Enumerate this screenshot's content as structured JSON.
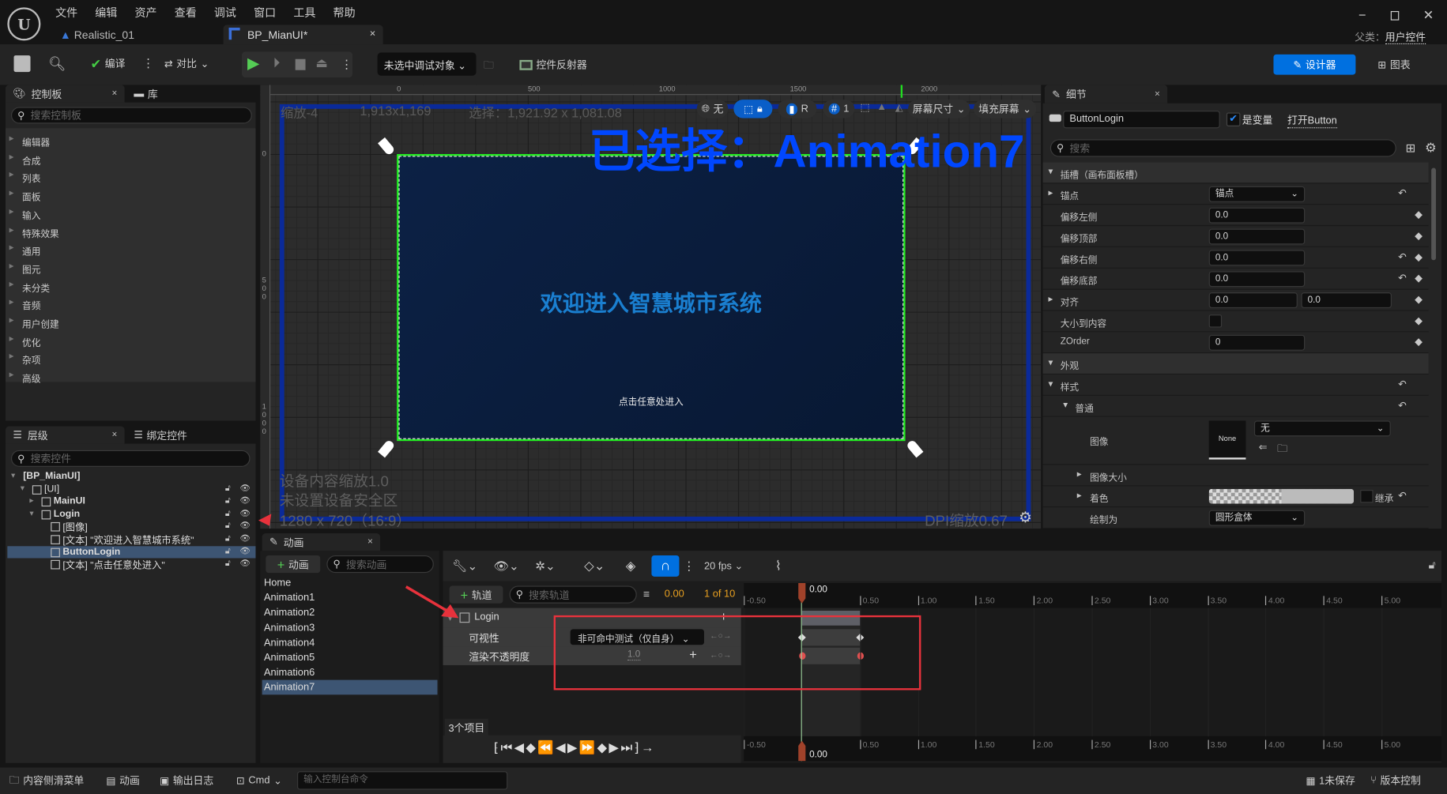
{
  "menu": [
    "文件",
    "编辑",
    "资产",
    "查看",
    "调试",
    "窗口",
    "工具",
    "帮助"
  ],
  "doc_tabs": [
    {
      "label": "Realistic_01"
    },
    {
      "label": "BP_MianUI*"
    }
  ],
  "parent_class": {
    "label": "父类：",
    "value": "用户控件"
  },
  "toolbar": {
    "compile": "编译",
    "diff": "对比",
    "debug_target": "未选中调试对象",
    "widget_reflector": "控件反射器",
    "designer": "设计器",
    "graph": "图表"
  },
  "palette": {
    "tab": "控制板",
    "library_tab": "库",
    "search_placeholder": "搜索控制板",
    "categories": [
      "编辑器",
      "合成",
      "列表",
      "面板",
      "输入",
      "特殊效果",
      "通用",
      "图元",
      "未分类",
      "音频",
      "用户创建",
      "优化",
      "杂项",
      "高级"
    ]
  },
  "hierarchy": {
    "tab": "层级",
    "bind_tab": "绑定控件",
    "search_placeholder": "搜索控件",
    "items": [
      {
        "label": "[BP_MianUI]",
        "depth": 0
      },
      {
        "label": "[UI]",
        "depth": 1
      },
      {
        "label": "MainUI",
        "depth": 2
      },
      {
        "label": "Login",
        "depth": 2
      },
      {
        "label": "[图像]",
        "depth": 3
      },
      {
        "label": "[文本] \"欢迎进入智慧城市系统\"",
        "depth": 3
      },
      {
        "label": "ButtonLogin",
        "depth": 3,
        "selected": true
      },
      {
        "label": "[文本] \"点击任意处进入\"",
        "depth": 3
      }
    ]
  },
  "canvas": {
    "ruler_x": [
      "0",
      "500",
      "1000",
      "1500",
      "2000"
    ],
    "ruler_y": [
      "0",
      "500",
      "1000"
    ],
    "zoom": "缩放-4",
    "size": "1,913x1,169",
    "selection": "选择：1,921.92 x 1,081.08",
    "overlay_title": "已选择：Animation7",
    "widget_title": "欢迎进入智慧城市系统",
    "widget_subtitle": "点击任意处进入",
    "device_scale": "设备内容缩放1.0",
    "safe_zone": "未设置设备安全区",
    "resolution": "1280 x 720（16:9）",
    "dpi": "DPI缩放0.67",
    "tb_none": "无",
    "tb_r": "R",
    "tb_grid": "1",
    "screen_size": "屏幕尺寸",
    "fill_screen": "填充屏幕"
  },
  "details": {
    "tab": "细节",
    "name": "ButtonLogin",
    "is_variable": "是变量",
    "open": "打开Button",
    "search_placeholder": "搜索",
    "slot_header": "插槽（画布面板槽）",
    "anchor": "锚点",
    "anchor_value": "锚点",
    "offset_left": "偏移左侧",
    "offset_top": "偏移顶部",
    "offset_right": "偏移右侧",
    "offset_bottom": "偏移底部",
    "offset_value": "0.0",
    "alignment": "对齐",
    "align_x": "0.0",
    "align_y": "0.0",
    "size_to_content": "大小到内容",
    "zorder": "ZOrder",
    "zorder_value": "0",
    "appearance": "外观",
    "style": "样式",
    "normal": "普通",
    "image": "图像",
    "image_thumb": "None",
    "image_value": "无",
    "image_size": "图像大小",
    "tint": "着色",
    "inherit": "继承",
    "draw_as": "绘制为",
    "draw_as_value": "圆形盒体"
  },
  "animations": {
    "tab": "动画",
    "add": "动画",
    "search_placeholder": "搜索动画",
    "items": [
      "Home",
      "Animation1",
      "Animation2",
      "Animation3",
      "Animation4",
      "Animation5",
      "Animation6",
      "Animation7"
    ],
    "selected": 7
  },
  "sequencer": {
    "fps": "20 fps",
    "add_track": "轨道",
    "search_placeholder": "搜索轨道",
    "time": "0.00",
    "frame_of": "1 of 10",
    "track": "Login",
    "visibility": "可视性",
    "visibility_value": "非可命中测试（仅自身）",
    "opacity": "渲染不透明度",
    "opacity_value": "1.0",
    "count": "3个项目",
    "playhead": "0.00",
    "ticks": [
      "-0.50",
      "0.50",
      "1.00",
      "1.50",
      "2.00",
      "2.50",
      "3.00",
      "3.50",
      "4.00",
      "4.50",
      "5.00"
    ]
  },
  "statusbar": {
    "content_drawer": "内容侧滑菜单",
    "anim": "动画",
    "output_log": "输出日志",
    "cmd": "Cmd",
    "console_placeholder": "输入控制台命令",
    "unsaved": "1未保存",
    "source_control": "版本控制"
  },
  "colors": {
    "accent": "#0070e0",
    "selection": "#3d5573",
    "highlight_box": "#e8323c",
    "overlay_text": "#0047ff",
    "widget_text": "#1a7fd0",
    "green_border": "#22ee22"
  }
}
